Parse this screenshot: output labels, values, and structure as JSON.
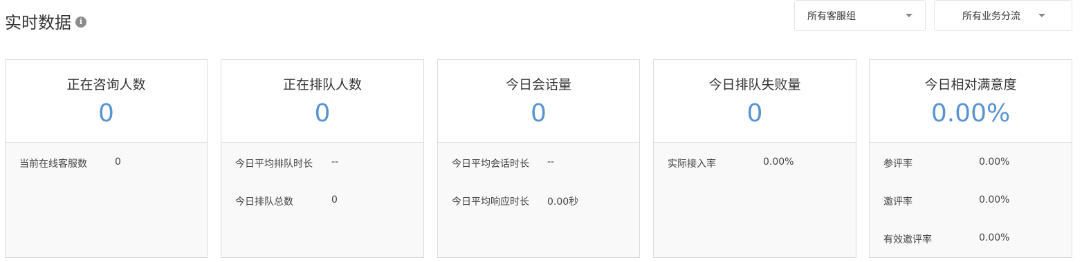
{
  "header": {
    "title": "实时数据",
    "info_icon": "info-icon",
    "info_glyph": "i"
  },
  "filters": {
    "group_select": "所有客服组",
    "business_select": "所有业务分流"
  },
  "cards": [
    {
      "title": "正在咨询人数",
      "value": "0",
      "rows": [
        {
          "label": "当前在线客服数",
          "value": "0"
        }
      ]
    },
    {
      "title": "正在排队人数",
      "value": "0",
      "rows": [
        {
          "label": "今日平均排队时长",
          "value": "--"
        },
        {
          "label": "今日排队总数",
          "value": "0"
        }
      ]
    },
    {
      "title": "今日会话量",
      "value": "0",
      "rows": [
        {
          "label": "今日平均会话时长",
          "value": "--"
        },
        {
          "label": "今日平均响应时长",
          "value": "0.00秒"
        }
      ]
    },
    {
      "title": "今日排队失败量",
      "value": "0",
      "rows": [
        {
          "label": "实际接入率",
          "value": "0.00%"
        }
      ]
    },
    {
      "title": "今日相对满意度",
      "value": "0.00%",
      "rows": [
        {
          "label": "参评率",
          "value": "0.00%"
        },
        {
          "label": "邀评率",
          "value": "0.00%"
        },
        {
          "label": "有效邀评率",
          "value": "0.00%"
        }
      ]
    }
  ],
  "colors": {
    "accent_value": "#5a94d0",
    "card_border": "#dcdcdc",
    "card_body_bg": "#f9f9f9",
    "info_icon_bg": "#8c8c8c"
  }
}
